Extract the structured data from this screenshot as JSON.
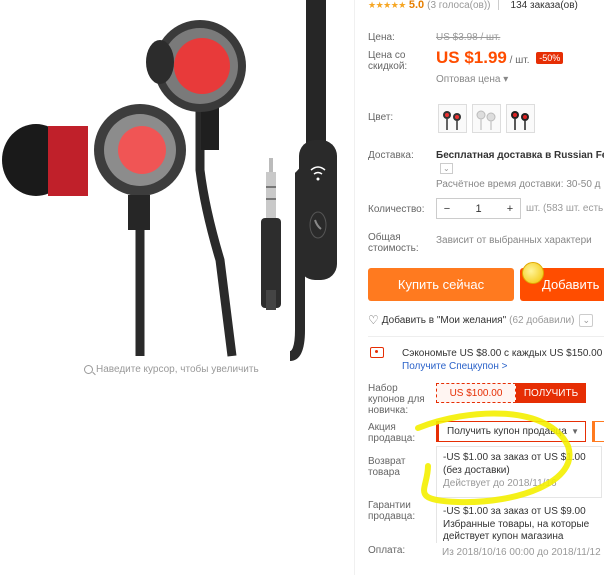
{
  "image": {
    "zoom_hint": "Наведите курсор, чтобы увеличить",
    "zoom_icon": "magnifier-icon"
  },
  "rating": {
    "stars": "★★★★★",
    "value": "5.0",
    "votes": "(3 голоса(ов))",
    "orders": "134 заказа(ов)"
  },
  "price": {
    "label_price": "Цена:",
    "old_price": "US $3.98 / шт.",
    "label_sale": "Цена со скидкой:",
    "new_price": "US $1.99",
    "per_unit": "/ шт.",
    "discount": "-50%",
    "bulk_price": "Оптовая цена ▾"
  },
  "color": {
    "label": "Цвет:",
    "swatches": [
      "black-red",
      "white",
      "black-red-2"
    ]
  },
  "delivery": {
    "label": "Доставка:",
    "value": "Бесплатная доставка в Russian Fed",
    "estimate": "Расчётное время доставки: 30-50 д"
  },
  "quantity": {
    "label": "Количество:",
    "minus": "−",
    "value": "1",
    "plus": "+",
    "note": "шт. (583 шт. есть в"
  },
  "total": {
    "label": "Общая стоимость:",
    "value": "Зависит от выбранных характери"
  },
  "buttons": {
    "buy_now": "Купить сейчас",
    "add_to_cart": "Добавить"
  },
  "wishlist": {
    "label": "Добавить в \"Мои желания\"",
    "count": "(62 добавили)"
  },
  "promo": {
    "save_text": "Сэкономьте US $8.00 с каждых US $150.00",
    "link": "Получите Спецкупон >"
  },
  "newbie": {
    "label": "Набор купонов для новичка:",
    "amount": "US $100.00",
    "button": "ПОЛУЧИТЬ"
  },
  "seller_promo": {
    "label": "Акция продавца:",
    "select": "Получить купон продавца"
  },
  "returns": {
    "label": "Возврат товара",
    "coupon_line1": "-US $1.00 за заказ от US $1.00",
    "coupon_line2": "(без доставки)",
    "coupon_exp": "Действует до 2018/11/16"
  },
  "guarantee": {
    "label": "Гарантии продавца:",
    "line1": "-US $1.00 за заказ от US $9.00",
    "line2": "Избранные товары, на которые",
    "line3": "действует купон магазина"
  },
  "payment": {
    "label": "Оплата:",
    "value": "Из 2018/10/16 00:00 до 2018/11/12"
  },
  "colors": {
    "accent": "#ff4d00",
    "buy": "#ff7a1f",
    "red": "#e62e04",
    "link": "#2a62c9",
    "highlight": "#f4f000"
  }
}
